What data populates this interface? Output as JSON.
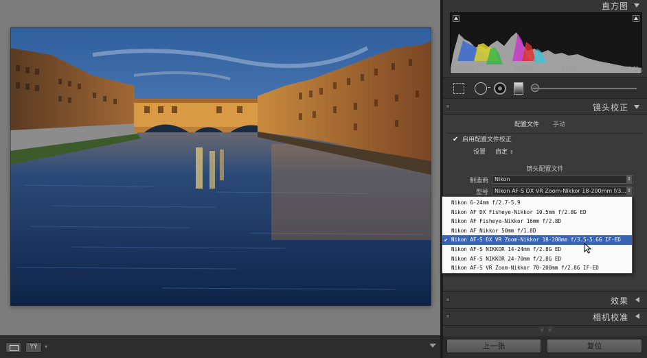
{
  "histogram_panel": {
    "title": "直方图",
    "exif": {
      "iso": "ISO 200",
      "focal": "18 mm",
      "aperture": "f / 22",
      "shutter": "1/13 秒"
    }
  },
  "tools": [
    "crop-icon",
    "spot-removal-icon",
    "red-eye-icon",
    "graduated-filter-icon",
    "adjustment-brush-icon"
  ],
  "lens_panel": {
    "title": "镜头校正",
    "tabs": [
      {
        "label": "配置文件",
        "active": true
      },
      {
        "label": "手动",
        "active": false
      }
    ],
    "enable_label": "启用配置文件校正",
    "enabled": true,
    "setup_label": "设置",
    "setup_value": "自定",
    "profile_section_title": "镜头配置文件",
    "make_label": "制造商",
    "make_value": "Nikon",
    "model_label": "型号",
    "model_value": "Nikon AF-S DX VR Zoom-Nikkor 18-200mm f/3...."
  },
  "lens_menu": {
    "items": [
      {
        "label": "Nikon 6-24mm f/2.7-5.9",
        "selected": false
      },
      {
        "label": "Nikon AF DX Fisheye-Nikkor 10.5mm f/2.8G ED",
        "selected": false
      },
      {
        "label": "Nikon AF Fisheye-Nikkor 16mm f/2.8D",
        "selected": false
      },
      {
        "label": "Nikon AF Nikkor 50mm f/1.8D",
        "selected": false
      },
      {
        "label": "Nikon AF-S DX VR Zoom-Nikkor 18-200mm f/3.5-5.6G IF-ED",
        "selected": true
      },
      {
        "label": "Nikon AF-S NIKKOR 14-24mm f/2.8G ED",
        "selected": false
      },
      {
        "label": "Nikon AF-S NIKKOR 24-70mm f/2.8G ED",
        "selected": false
      },
      {
        "label": "Nikon AF-S VR Zoom-Nikkor 70-200mm f/2.8G IF-ED",
        "selected": false
      }
    ]
  },
  "effects_panel": {
    "title": "效果"
  },
  "camera_panel": {
    "title": "相机校准"
  },
  "buttons": {
    "prev": "上一张",
    "reset": "复位"
  },
  "toolbar": {
    "compare_label": "YY"
  },
  "colors": {
    "selection": "#3a64b4",
    "panel_bg": "#353535",
    "viewer_bg": "#7c7c7c"
  }
}
